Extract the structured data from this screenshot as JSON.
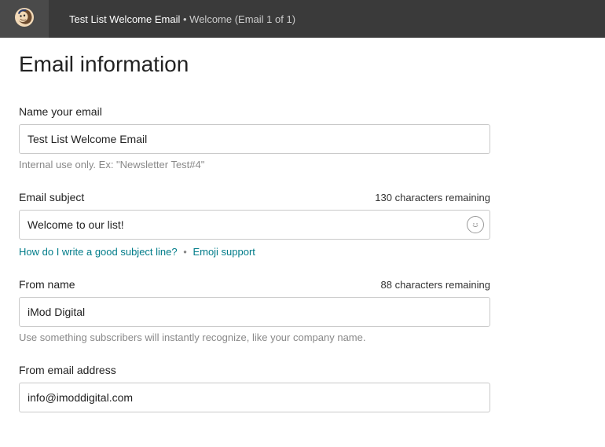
{
  "header": {
    "crumb_primary": "Test List Welcome Email",
    "crumb_secondary": "Welcome (Email 1 of 1)"
  },
  "page": {
    "title": "Email information"
  },
  "fields": {
    "name": {
      "label": "Name your email",
      "value": "Test List Welcome Email",
      "hint": "Internal use only. Ex: \"Newsletter Test#4\""
    },
    "subject": {
      "label": "Email subject",
      "counter": "130 characters remaining",
      "value": "Welcome to our list!",
      "link_subject": "How do I write a good subject line?",
      "link_emoji": "Emoji support"
    },
    "from_name": {
      "label": "From name",
      "counter": "88 characters remaining",
      "value": "iMod Digital",
      "hint": "Use something subscribers will instantly recognize, like your company name."
    },
    "from_email": {
      "label": "From email address",
      "value": "info@imoddigital.com"
    }
  },
  "separators": {
    "dot": "•"
  }
}
